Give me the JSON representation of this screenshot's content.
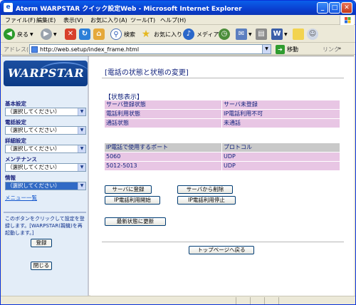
{
  "window": {
    "title": "Aterm WARPSTAR クイック設定Web - Microsoft Internet Explorer",
    "min_glyph": "_",
    "max_glyph": "□",
    "close_glyph": "✕"
  },
  "menubar": {
    "items": [
      "ファイル(F)",
      "編集(E)",
      "表示(V)",
      "お気に入り(A)",
      "ツール(T)",
      "ヘルプ(H)"
    ]
  },
  "toolbar": {
    "back_label": "戻る",
    "search_label": "検索",
    "favorites_label": "お気に入り",
    "media_label": "メディア"
  },
  "addressbar": {
    "label": "アドレス(D)",
    "url": "http://web.setup/index_frame.html",
    "go_label": "移動",
    "links_label": "リンク",
    "links_more": "»"
  },
  "sidebar": {
    "logo_text": "WARPSTAR",
    "groups": [
      {
        "label": "基本設定",
        "selected": "（選択してください）"
      },
      {
        "label": "電話設定",
        "selected": "（選択してください）"
      },
      {
        "label": "詳細設定",
        "selected": "（選択してください）"
      },
      {
        "label": "メンテナンス",
        "selected": "（選択してください）"
      },
      {
        "label": "情報",
        "selected": "（選択してください）"
      }
    ],
    "menu_list_link": "メニュー一覧",
    "help_text": "このボタンをクリックして設定を登録します。[WARPSTAR(親機)を再起動します。]",
    "register_button": "登録",
    "close_button": "閉じる"
  },
  "main": {
    "heading": "[電話の状態と状態の変更]",
    "section_title": "【状態表示】",
    "status_rows": [
      {
        "label": "サーバ登録状態",
        "value": "サーバ未登録"
      },
      {
        "label": "電話利用状態",
        "value": "IP電話利用不可"
      },
      {
        "label": "通話状態",
        "value": "未通話"
      }
    ],
    "port_table": {
      "headers": [
        "IP電話で使用するポート",
        "プロトコル"
      ],
      "rows": [
        [
          "5060",
          "UDP"
        ],
        [
          "5012-5013",
          "UDP"
        ]
      ]
    },
    "buttons": {
      "register_server": "サーバに登録",
      "delete_server": "サーバから削除",
      "ip_start": "IP電話利用開始",
      "ip_stop": "IP電話利用停止",
      "refresh": "最新状態に更新",
      "top_page": "トップページへ戻る"
    }
  },
  "colors": {
    "title_bar": "#0A5FEA",
    "status_cell": "#E8C6E4",
    "header_cell": "#C9C9C9",
    "heading_text": "#0d1e7a",
    "sidebar_bg": "#E3EDF8"
  }
}
